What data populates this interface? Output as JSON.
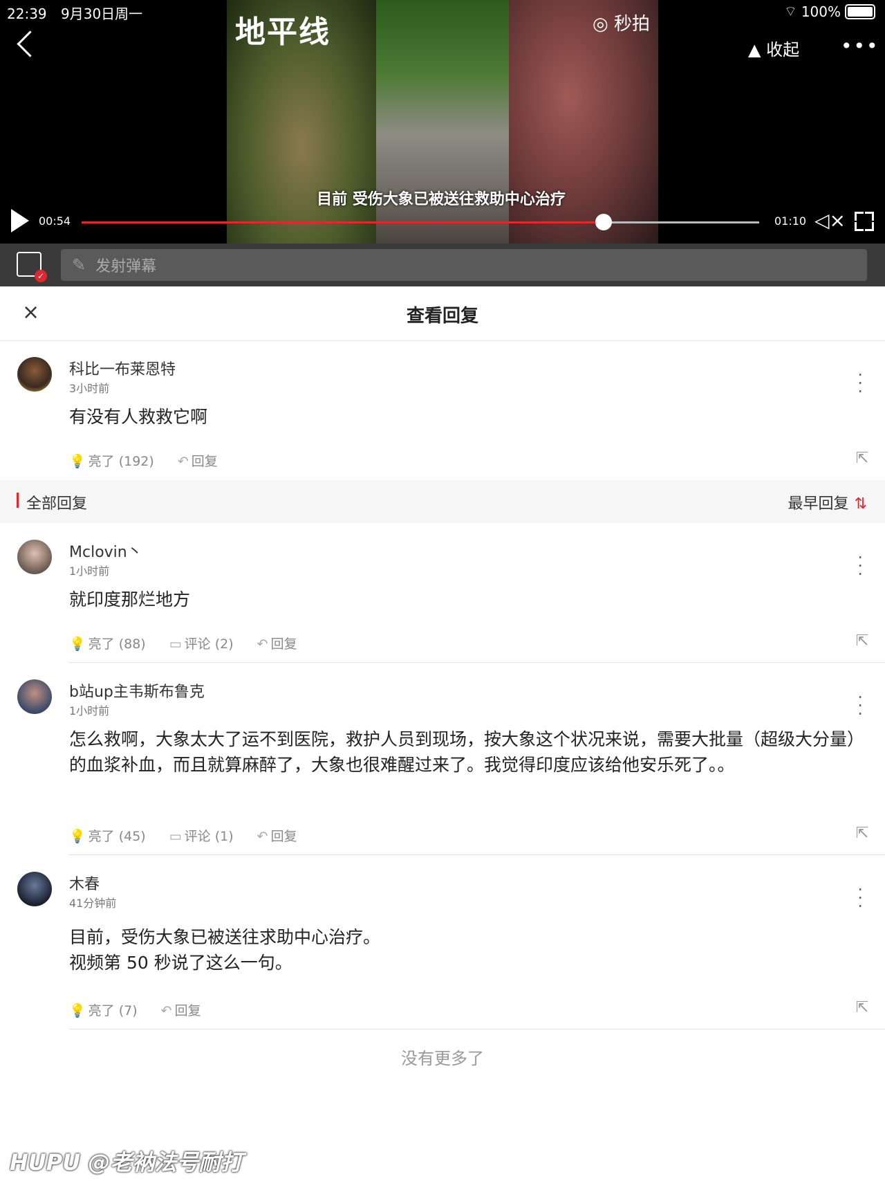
{
  "status_bar": {
    "time": "22:39",
    "date": "9月30日周一",
    "battery": "100%"
  },
  "video": {
    "logo": "地平线",
    "miaopai": "◎ 秒拍",
    "subtitle": "目前 受伤大象已被送往救助中心治疗",
    "collapse_label": "▲ 收起",
    "more": "•••",
    "current_time": "00:54",
    "total_time": "01:10",
    "progress": 0.77
  },
  "danmu": {
    "placeholder": "发射弹幕"
  },
  "sheet": {
    "title": "查看回复",
    "close": "×"
  },
  "main_comment": {
    "user": "科比一布莱恩特",
    "time": "3小时前",
    "text": "有没有人救救它啊",
    "likes": "亮了 (192)",
    "reply": "回复"
  },
  "section": {
    "label": "全部回复",
    "sort_label": "最早回复",
    "sort_icon": "⇅"
  },
  "replies": [
    {
      "user": "Mclovin丶",
      "time": "1小时前",
      "text": "就印度那烂地方",
      "likes": "亮了 (88)",
      "comments": "评论 (2)",
      "reply": "回复"
    },
    {
      "user": "b站up主韦斯布鲁克",
      "time": "1小时前",
      "text": "怎么救啊，大象太大了运不到医院，救护人员到现场，按大象这个状况来说，需要大批量（超级大分量）的血浆补血，而且就算麻醉了，大象也很难醒过来了。我觉得印度应该给他安乐死了。。",
      "likes": "亮了 (45)",
      "comments": "评论 (1)",
      "reply": "回复"
    },
    {
      "user": "木春",
      "time": "41分钟前",
      "text_line1": "目前，受伤大象已被送往求助中心治疗。",
      "text_line2": "视频第 50 秒说了这么一句。",
      "likes": "亮了 (7)",
      "reply": "回复"
    }
  ],
  "footer": {
    "no_more": "没有更多了",
    "watermark": "HUPU @老衲法号耐打"
  },
  "colors": {
    "accent": "#e0282e"
  }
}
